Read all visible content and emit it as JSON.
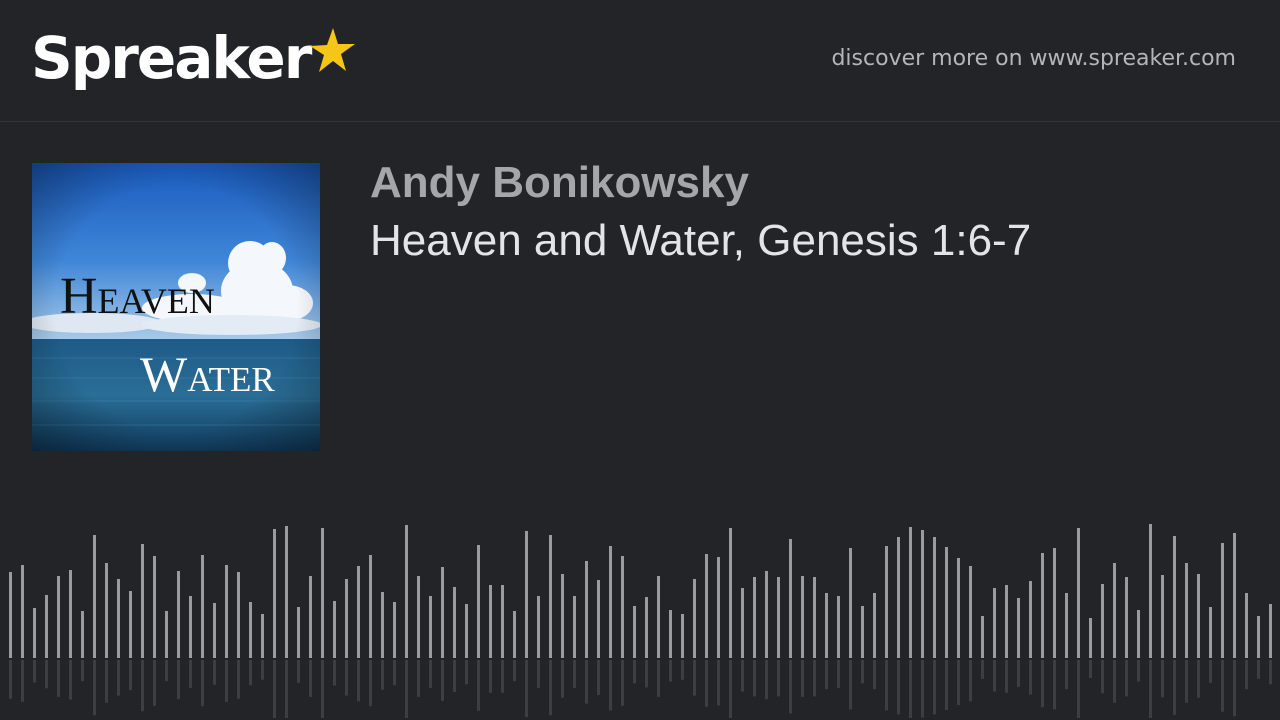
{
  "header": {
    "brand": "Spreaker",
    "tagline": "discover more on www.spreaker.com"
  },
  "cover": {
    "title_line1": "Heaven",
    "title_line2": "Water"
  },
  "episode": {
    "author": "Andy Bonikowsky",
    "title": "Heaven and Water, Genesis 1:6-7"
  },
  "colors": {
    "background": "#232428",
    "accent_star": "#f5c518",
    "wave": "#9a9b9f"
  }
}
